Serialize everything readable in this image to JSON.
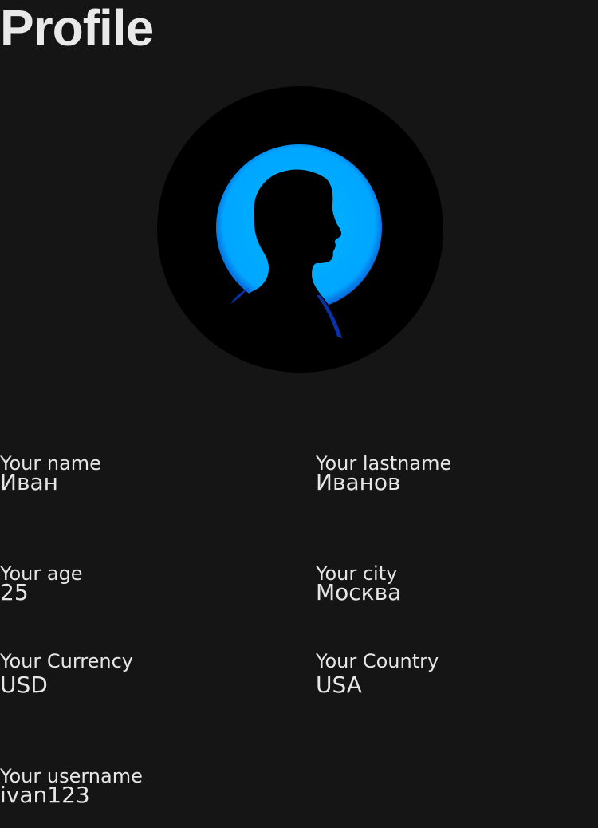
{
  "page": {
    "title": "Profile"
  },
  "avatar": {
    "icon": "person-silhouette-icon",
    "ring_color": "#00aaff",
    "background_color": "#000000"
  },
  "fields": {
    "name": {
      "label": "Your name",
      "value": "Иван"
    },
    "lastname": {
      "label": "Your lastname",
      "value": "Иванов"
    },
    "age": {
      "label": "Your age",
      "value": "25"
    },
    "city": {
      "label": "Your city",
      "value": "Москва"
    },
    "currency": {
      "label": "Your Currency",
      "value": "USD"
    },
    "country": {
      "label": "Your Country",
      "value": "USA"
    },
    "username": {
      "label": "Your username",
      "value": "ivan123"
    }
  },
  "colors": {
    "background": "#151515",
    "text": "#e6e6e6",
    "accent": "#00aaff"
  }
}
